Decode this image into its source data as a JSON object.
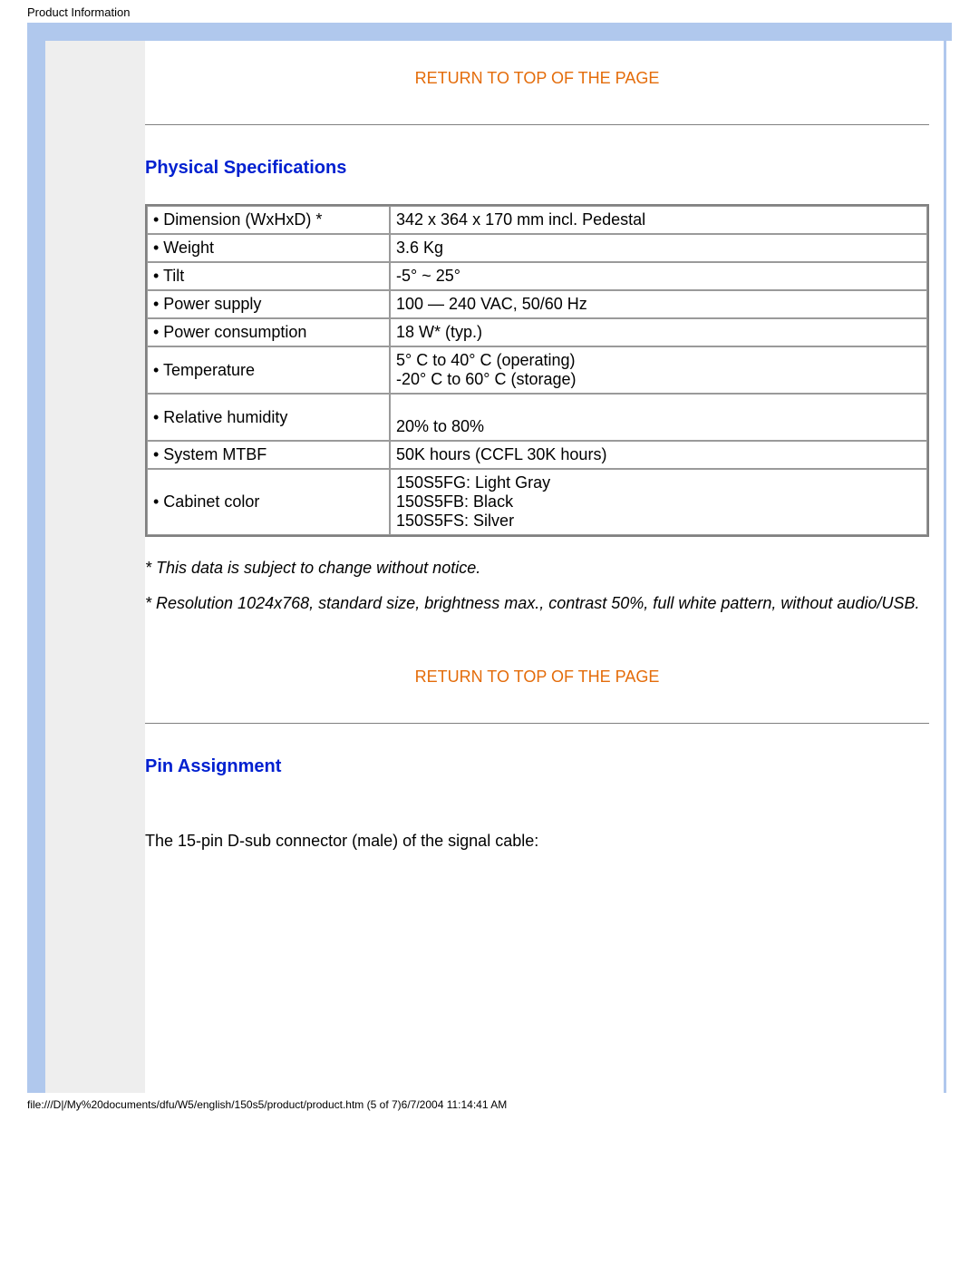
{
  "page": {
    "header_title": "Product Information",
    "footer": "file:///D|/My%20documents/dfu/W5/english/150s5/product/product.htm (5 of 7)6/7/2004 11:14:41 AM"
  },
  "links": {
    "return_top": "RETURN TO TOP OF THE PAGE"
  },
  "sections": {
    "physical": {
      "heading": "Physical Specifications",
      "rows": [
        {
          "label": "• Dimension (WxHxD) *",
          "value": "342 x 364 x 170 mm incl. Pedestal"
        },
        {
          "label": "• Weight",
          "value": "3.6 Kg"
        },
        {
          "label": "• Tilt",
          "value": "-5° ~ 25°"
        },
        {
          "label": "• Power supply",
          "value": "100 — 240 VAC, 50/60 Hz"
        },
        {
          "label": "• Power consumption",
          "value": "18 W* (typ.)"
        },
        {
          "label": "• Temperature",
          "value": "5° C to 40° C (operating)\n-20° C to 60° C (storage)"
        },
        {
          "label": "• Relative humidity",
          "value": "\n20% to 80%\n "
        },
        {
          "label": "• System MTBF",
          "value": "50K hours (CCFL 30K hours)"
        },
        {
          "label": "• Cabinet color",
          "value": "150S5FG: Light Gray\n150S5FB: Black\n150S5FS: Silver"
        }
      ],
      "note1": "* This data is subject to change without notice.",
      "note2": "* Resolution 1024x768, standard size, brightness max., contrast 50%, full white pattern, without audio/USB."
    },
    "pin": {
      "heading": "Pin Assignment",
      "intro": "The 15-pin D-sub connector (male) of the signal cable:"
    }
  }
}
